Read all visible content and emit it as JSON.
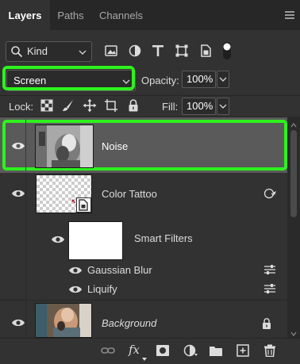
{
  "tabs": [
    {
      "label": "Layers",
      "active": true
    },
    {
      "label": "Paths",
      "active": false
    },
    {
      "label": "Channels",
      "active": false
    }
  ],
  "filter": {
    "kind_label": "Kind",
    "filter_icons": [
      "image-filter-icon",
      "adjustment-filter-icon",
      "type-filter-icon",
      "shape-filter-icon",
      "smart-object-filter-icon",
      "filter-toggle-icon"
    ]
  },
  "blend": {
    "mode": "Screen",
    "opacity_label": "Opacity:",
    "opacity_value": "100%"
  },
  "lock": {
    "label": "Lock:",
    "icons": [
      "lock-transparent-icon",
      "lock-image-icon",
      "lock-position-icon",
      "lock-artboard-icon",
      "lock-all-icon"
    ],
    "fill_label": "Fill:",
    "fill_value": "100%"
  },
  "layers": [
    {
      "name": "Noise",
      "selected": true,
      "visible": true
    },
    {
      "name": "Color Tattoo",
      "selected": false,
      "visible": true,
      "smart_filters_label": "Smart Filters",
      "filters": [
        "Gaussian Blur",
        "Liquify"
      ]
    },
    {
      "name": "Background",
      "selected": false,
      "visible": true,
      "locked": true
    }
  ],
  "bottom_icons": [
    "link-layers-icon",
    "fx-icon",
    "add-mask-icon",
    "adjustment-layer-icon",
    "new-group-icon",
    "new-layer-icon",
    "delete-layer-icon"
  ],
  "bottom_fx_text": "fx",
  "highlight_color": "#2df21d"
}
